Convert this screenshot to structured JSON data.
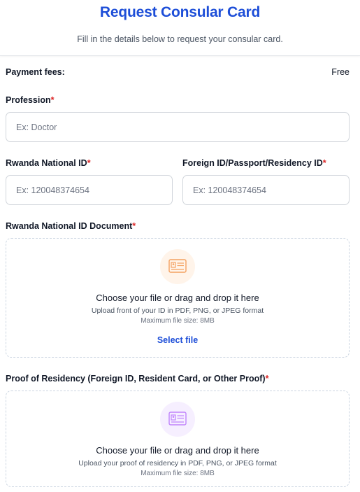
{
  "header": {
    "title": "Request Consular Card",
    "subtitle": "Fill in the details below to request your consular card."
  },
  "payment": {
    "label": "Payment fees:",
    "value": "Free"
  },
  "form": {
    "required_mark": "*",
    "profession": {
      "label": "Profession",
      "placeholder": "Ex: Doctor",
      "value": ""
    },
    "national_id": {
      "label": "Rwanda National ID",
      "placeholder": "Ex: 120048374654",
      "value": ""
    },
    "foreign_id": {
      "label": "Foreign ID/Passport/Residency ID",
      "placeholder": "Ex: 120048374654",
      "value": ""
    },
    "id_document": {
      "label": "Rwanda National ID Document",
      "icon": "id-card-icon",
      "icon_color": "#f4a261",
      "icon_bg": "#fff4ea",
      "title": "Choose your file or drag and drop it here",
      "hint": "Upload front of your ID in PDF, PNG, or JPEG format",
      "max": "Maximum file size: 8MB",
      "select_label": "Select file"
    },
    "residency_proof": {
      "label": "Proof of Residency (Foreign ID, Resident Card, or Other Proof)",
      "icon": "id-card-icon",
      "icon_color": "#c084fc",
      "icon_bg": "#f6efff",
      "title": "Choose your file or drag and drop it here",
      "hint": "Upload your proof of residency in PDF, PNG, or JPEG format",
      "max": "Maximum file size: 8MB"
    }
  },
  "colors": {
    "accent": "#1d4ed8",
    "required": "#dc2626"
  }
}
